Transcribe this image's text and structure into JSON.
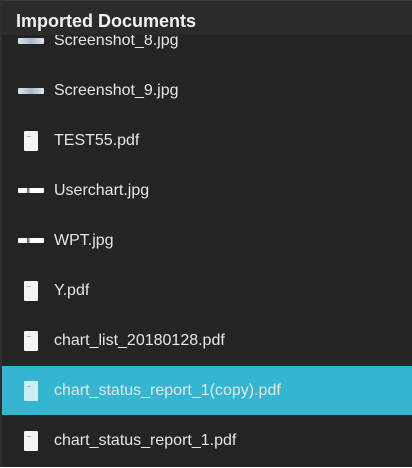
{
  "panel": {
    "title": "Imported Documents"
  },
  "files": [
    {
      "name": "Screenshot_8.jpg",
      "type": "image",
      "icon": "image-file-icon"
    },
    {
      "name": "Screenshot_9.jpg",
      "type": "image",
      "icon": "image-file-icon"
    },
    {
      "name": "TEST55.pdf",
      "type": "pdf",
      "icon": "pdf-file-icon"
    },
    {
      "name": "Userchart.jpg",
      "type": "image-dark",
      "icon": "image-file-icon"
    },
    {
      "name": "WPT.jpg",
      "type": "image-dark",
      "icon": "image-file-icon"
    },
    {
      "name": "Y.pdf",
      "type": "pdf",
      "icon": "pdf-file-icon"
    },
    {
      "name": "chart_list_20180128.pdf",
      "type": "pdf",
      "icon": "pdf-file-icon"
    },
    {
      "name": "chart_status_report_1(copy).pdf",
      "type": "pdf",
      "icon": "pdf-file-icon",
      "selected": true
    },
    {
      "name": "chart_status_report_1.pdf",
      "type": "pdf",
      "icon": "pdf-file-icon"
    }
  ],
  "colors": {
    "background": "#242424",
    "selection": "#35b6d0",
    "text": "#e6e6e6"
  }
}
